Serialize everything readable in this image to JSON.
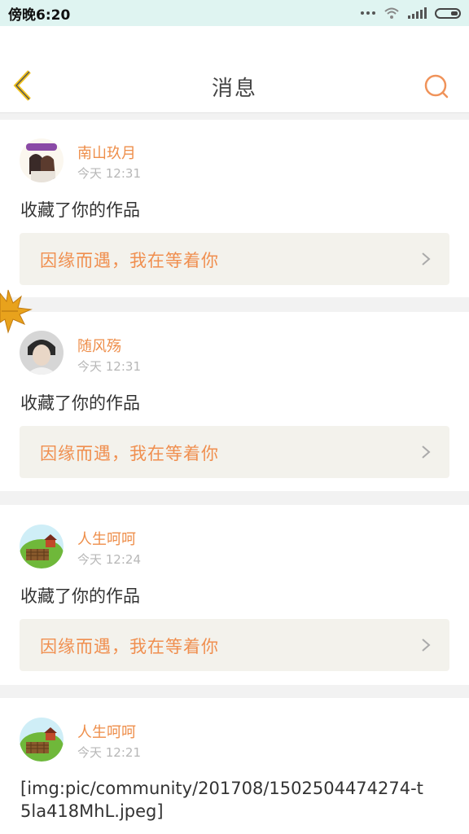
{
  "status_bar": {
    "time": "傍晚6:20"
  },
  "header": {
    "title": "消息"
  },
  "feed": [
    {
      "user": "南山玖月",
      "time": "今天 12:31",
      "action": "收藏了你的作品",
      "work": "因缘而遇，我在等着你"
    },
    {
      "user": "随风殇",
      "time": "今天 12:31",
      "action": "收藏了你的作品",
      "work": "因缘而遇，我在等着你"
    },
    {
      "user": "人生呵呵",
      "time": "今天 12:24",
      "action": "收藏了你的作品",
      "work": "因缘而遇，我在等着你"
    },
    {
      "user": "人生呵呵",
      "time": "今天 12:21",
      "content": "[img:pic/community/201708/1502504474274-t5la418MhL.jpeg]"
    }
  ],
  "colors": {
    "accent": "#ee8e4a",
    "status_bar_bg": "#dff4f1",
    "link_bg": "#f3f2ec",
    "back_icon": "#f2c21a"
  },
  "icons": [
    "back-arrow-icon",
    "search-icon",
    "chevron-right-icon",
    "maple-leaf-icon"
  ]
}
